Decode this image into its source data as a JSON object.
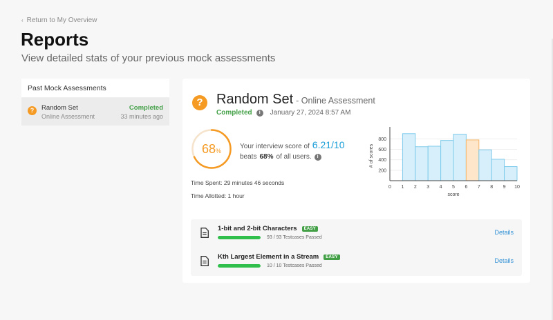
{
  "nav": {
    "back_label": "Return to My Overview"
  },
  "page": {
    "title": "Reports",
    "subtitle": "View detailed stats of your previous mock assessments"
  },
  "sidebar": {
    "header": "Past Mock Assessments",
    "items": [
      {
        "name": "Random Set",
        "type": "Online Assessment",
        "status": "Completed",
        "time": "33 minutes ago"
      }
    ]
  },
  "report": {
    "title": "Random Set",
    "type": "- Online Assessment",
    "status": "Completed",
    "date": "January 27, 2024 8:57 AM",
    "percent": "68",
    "percent_sign": "%",
    "percent_fraction": 0.68,
    "score_prefix": "Your interview score of",
    "score": "6.21/10",
    "beats_prefix": "beats",
    "beats_value": "68%",
    "beats_suffix": "of all users.",
    "time_spent": "Time Spent: 29 minutes 46 seconds",
    "time_allotted": "Time Allotted: 1 hour",
    "problems": [
      {
        "name": "1-bit and 2-bit Characters",
        "difficulty": "EASY",
        "passed": "93 / 93 Testcases Passed",
        "fraction": 1.0,
        "details": "Details"
      },
      {
        "name": "Kth Largest Element in a Stream",
        "difficulty": "EASY",
        "passed": "10 / 10 Testcases Passed",
        "fraction": 1.0,
        "details": "Details"
      }
    ]
  },
  "chart_data": {
    "type": "bar",
    "x_edges": [
      0,
      1,
      2,
      3,
      4,
      5,
      6,
      7,
      8,
      9,
      10
    ],
    "values": [
      0,
      900,
      650,
      660,
      770,
      890,
      780,
      590,
      410,
      270
    ],
    "highlight_bin": 6,
    "xlabel": "score",
    "ylabel": "# of scores",
    "yticks": [
      200,
      400,
      600,
      800
    ],
    "ylim": [
      0,
      950
    ],
    "colors": {
      "normal_fill": "#d6effa",
      "normal_stroke": "#7fcbeb",
      "highlight_fill": "#fde6c9",
      "highlight_stroke": "#f5b56a"
    }
  },
  "colors": {
    "accent_orange": "#f59a23",
    "success_green": "#43a047",
    "link_blue": "#2d8fd5",
    "score_blue": "#1a9ed8"
  }
}
